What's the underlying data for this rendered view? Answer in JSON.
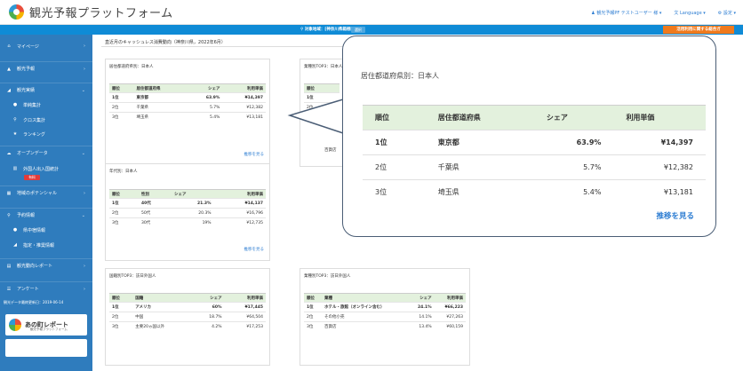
{
  "app": {
    "logo_text": "観光予報プラットフォーム",
    "user": "観光予報PF テストユーザー 様",
    "language": "Language",
    "settings": "設定"
  },
  "subbar": {
    "region": "対象地域：[神奈川県箱根町]",
    "region_button": "選択",
    "orange_button": "活用利用に関する総合ガ"
  },
  "sidebar": {
    "items": [
      {
        "icon": "home-icon",
        "glyph": "⌂",
        "label": "マイページ"
      },
      {
        "icon": "chart-icon",
        "glyph": "▲",
        "label": "観光予報"
      },
      {
        "icon": "analysis-icon",
        "glyph": "◢",
        "label": "観光実績"
      },
      {
        "icon": "dot-icon",
        "glyph": "●",
        "label": "単純集計"
      },
      {
        "icon": "search-icon",
        "glyph": "⚲",
        "label": "クロス集計"
      },
      {
        "icon": "star-icon",
        "glyph": "★",
        "label": "ランキング"
      },
      {
        "icon": "cloud-icon",
        "glyph": "☁",
        "label": "オープンデータ"
      },
      {
        "icon": "bar-icon",
        "glyph": "▥",
        "label": "外国人出入国統計"
      },
      {
        "icon": "grid-icon",
        "glyph": "▦",
        "label": "地域のポテンシャル"
      },
      {
        "icon": "search-icon",
        "glyph": "⚲",
        "label": "予約情報"
      },
      {
        "icon": "dot-icon",
        "glyph": "●",
        "label": "県中宿情報"
      },
      {
        "icon": "area-icon",
        "glyph": "◢",
        "label": "指定・推奨情報"
      },
      {
        "icon": "doc-icon",
        "glyph": "▤",
        "label": "観光動向レポート"
      },
      {
        "icon": "list-icon",
        "glyph": "☰",
        "label": "アンケート"
      }
    ],
    "badge": "有料",
    "update_text": "観光データ最終更新日：2019-06-14",
    "banner_title": "あの町レポート",
    "banner_sub": "観光予報プラットフォーム"
  },
  "main": {
    "heading": "直近月のキャッシュレス消費動向（神奈川県，2022年6月）",
    "more_label": "推移を見る",
    "card_residence": {
      "title": "居住都道府県別：日本人",
      "headers": [
        "順位",
        "居住都道府県",
        "シェア",
        "利用単価"
      ],
      "rows": [
        [
          "1位",
          "東京都",
          "63.9%",
          "¥14,397"
        ],
        [
          "2位",
          "千葉県",
          "5.7%",
          "¥12,382"
        ],
        [
          "3位",
          "埼玉県",
          "5.4%",
          "¥13,181"
        ]
      ]
    },
    "card_industry_top": {
      "title": "業種別TOP3：日本人",
      "headers": [
        "順位"
      ],
      "rows": [
        [
          "1位"
        ],
        [
          "2位"
        ],
        [
          "3位"
        ]
      ],
      "row3_extra": "百貨店"
    },
    "card_age": {
      "title": "年代別：日本人",
      "headers": [
        "順位",
        "性別",
        "シェア",
        "利用単価"
      ],
      "rows": [
        [
          "1位",
          "40代",
          "21.3%",
          "¥14,137"
        ],
        [
          "2位",
          "50代",
          "20.3%",
          "¥16,796"
        ],
        [
          "3位",
          "30代",
          "19%",
          "¥12,735"
        ]
      ]
    },
    "card_country": {
      "title": "国籍別TOP3：訪日外国人",
      "headers": [
        "順位",
        "国籍",
        "シェア",
        "利用単価"
      ],
      "rows": [
        [
          "1位",
          "アメリカ",
          "60%",
          "¥17,445"
        ],
        [
          "2位",
          "中国",
          "18.7%",
          "¥64,504"
        ],
        [
          "3位",
          "主要20ヵ国以外",
          "4.2%",
          "¥17,253"
        ]
      ]
    },
    "card_industry_foreign": {
      "title": "業種別TOP3：訪日外国人",
      "headers": [
        "順位",
        "業種",
        "シェア",
        "利用単価"
      ],
      "rows": [
        [
          "1位",
          "ホテル・旅館（オンライン含む）",
          "24.1%",
          "¥66,223"
        ],
        [
          "2位",
          "その他小売",
          "14.1%",
          "¥27,263"
        ],
        [
          "3位",
          "百貨店",
          "13.4%",
          "¥60,159"
        ]
      ]
    }
  },
  "zoom": {
    "title": "居住都道府県別：日本人",
    "headers": [
      "順位",
      "居住都道府県",
      "シェア",
      "利用単価"
    ],
    "rows": [
      [
        "1位",
        "東京都",
        "63.9%",
        "¥14,397"
      ],
      [
        "2位",
        "千葉県",
        "5.7%",
        "¥12,382"
      ],
      [
        "3位",
        "埼玉県",
        "5.4%",
        "¥13,181"
      ]
    ],
    "more": "推移を見る"
  }
}
